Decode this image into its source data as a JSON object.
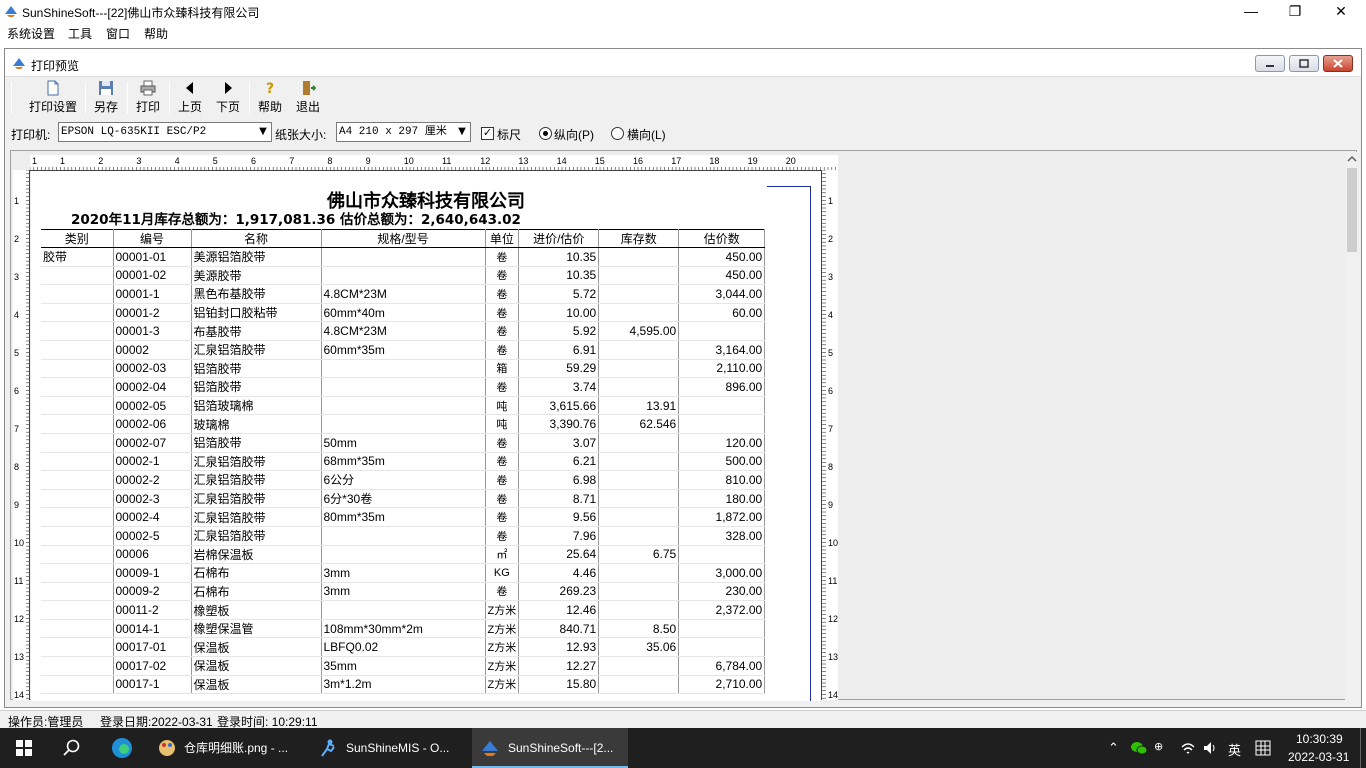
{
  "window": {
    "title": "SunShineSoft---[22]佛山市众臻科技有限公司",
    "minimize": "—",
    "restore": "❐",
    "close": "✕"
  },
  "menu": [
    "系统设置",
    "工具",
    "窗口",
    "帮助"
  ],
  "child": {
    "title": "打印预览"
  },
  "toolbar": {
    "print_setup": "打印设置",
    "save_as": "另存",
    "print": "打印",
    "prev": "上页",
    "next": "下页",
    "help": "帮助",
    "exit": "退出"
  },
  "options": {
    "printer_label": "打印机:",
    "printer_value": "EPSON LQ-635KII ESC/P2",
    "paper_label": "纸张大小:",
    "paper_value": "A4 210 x 297 厘米",
    "ruler_label": "标尺",
    "ruler_checked": true,
    "portrait_label": "纵向(P)",
    "landscape_label": "横向(L)",
    "orientation": "portrait"
  },
  "ruler": {
    "top": [
      "1",
      "1",
      "2",
      "3",
      "4",
      "5",
      "6",
      "7",
      "8",
      "9",
      "10",
      "11",
      "12",
      "13",
      "14",
      "15",
      "16",
      "17",
      "18",
      "19",
      "20"
    ],
    "side": [
      "1",
      "2",
      "3",
      "4",
      "5",
      "6",
      "7",
      "8",
      "9",
      "10",
      "11",
      "12",
      "13",
      "14"
    ]
  },
  "report": {
    "title": "佛山市众臻科技有限公司",
    "summary": "2020年11月库存总额为：1,917,081.36     估价总额为：2,640,643.02",
    "headers": [
      "类别",
      "编号",
      "名称",
      "规格/型号",
      "单位",
      "进价/估价",
      "库存数",
      "估价数"
    ],
    "rows": [
      [
        "胶带",
        "00001-01",
        "美源铝箔胶带",
        "",
        "卷",
        "10.35",
        "",
        "450.00"
      ],
      [
        "",
        "00001-02",
        "美源胶带",
        "",
        "卷",
        "10.35",
        "",
        "450.00"
      ],
      [
        "",
        "00001-1",
        "黑色布基胶带",
        "4.8CM*23M",
        "卷",
        "5.72",
        "",
        "3,044.00"
      ],
      [
        "",
        "00001-2",
        "铝铂封口胶粘带",
        "60mm*40m",
        "卷",
        "10.00",
        "",
        "60.00"
      ],
      [
        "",
        "00001-3",
        "布基胶带",
        "4.8CM*23M",
        "卷",
        "5.92",
        "4,595.00",
        ""
      ],
      [
        "",
        "00002",
        "汇泉铝箔胶带",
        "60mm*35m",
        "卷",
        "6.91",
        "",
        "3,164.00"
      ],
      [
        "",
        "00002-03",
        "铝箔胶带",
        "",
        "箱",
        "59.29",
        "",
        "2,110.00"
      ],
      [
        "",
        "00002-04",
        "铝箔胶带",
        "",
        "卷",
        "3.74",
        "",
        "896.00"
      ],
      [
        "",
        "00002-05",
        "铝箔玻璃棉",
        "",
        "吨",
        "3,615.66",
        "13.91",
        ""
      ],
      [
        "",
        "00002-06",
        "玻璃棉",
        "",
        "吨",
        "3,390.76",
        "62.546",
        ""
      ],
      [
        "",
        "00002-07",
        "铝箔胶带",
        "50mm",
        "卷",
        "3.07",
        "",
        "120.00"
      ],
      [
        "",
        "00002-1",
        "汇泉铝箔胶带",
        "68mm*35m",
        "卷",
        "6.21",
        "",
        "500.00"
      ],
      [
        "",
        "00002-2",
        "汇泉铝箔胶带",
        "6公分",
        "卷",
        "6.98",
        "",
        "810.00"
      ],
      [
        "",
        "00002-3",
        "汇泉铝箔胶带",
        "6分*30卷",
        "卷",
        "8.71",
        "",
        "180.00"
      ],
      [
        "",
        "00002-4",
        "汇泉铝箔胶带",
        "80mm*35m",
        "卷",
        "9.56",
        "",
        "1,872.00"
      ],
      [
        "",
        "00002-5",
        "汇泉铝箔胶带",
        "",
        "卷",
        "7.96",
        "",
        "328.00"
      ],
      [
        "",
        "00006",
        "岩棉保温板",
        "",
        "㎡",
        "25.64",
        "6.75",
        ""
      ],
      [
        "",
        "00009-1",
        "石棉布",
        "3mm",
        "KG",
        "4.46",
        "",
        "3,000.00"
      ],
      [
        "",
        "00009-2",
        "石棉布",
        "3mm",
        "卷",
        "269.23",
        "",
        "230.00"
      ],
      [
        "",
        "00011-2",
        "橡塑板",
        "",
        "Z方米",
        "12.46",
        "",
        "2,372.00"
      ],
      [
        "",
        "00014-1",
        "橡塑保温管",
        "108mm*30mm*2m",
        "Z方米",
        "840.71",
        "8.50",
        ""
      ],
      [
        "",
        "00017-01",
        "保温板",
        "LBFQ0.02",
        "Z方米",
        "12.93",
        "35.06",
        ""
      ],
      [
        "",
        "00017-02",
        "保温板",
        "35mm",
        "Z方米",
        "12.27",
        "",
        "6,784.00"
      ],
      [
        "",
        "00017-1",
        "保温板",
        "3m*1.2m",
        "Z方米",
        "15.80",
        "",
        "2,710.00"
      ]
    ]
  },
  "status": {
    "operator": "操作员:管理员",
    "login_date": "登录日期:2022-03-31",
    "login_time": "登录时间: 10:29:11"
  },
  "taskbar": {
    "items": [
      "仓库明细账.png - ...",
      "SunShineMIS - O...",
      "SunShineSoft---[2..."
    ],
    "ime": "英",
    "time": "10:30:39",
    "date": "2022-03-31"
  }
}
